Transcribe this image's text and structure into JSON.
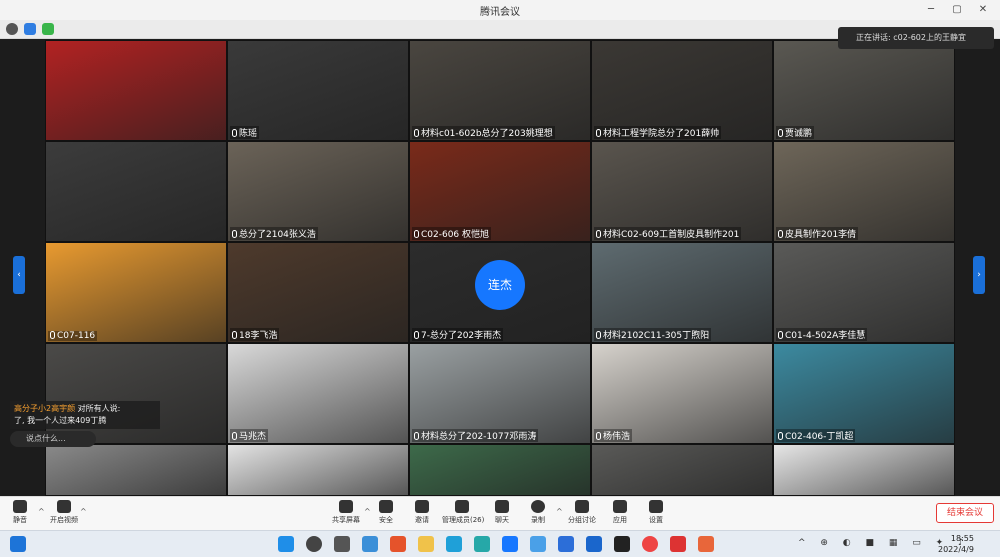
{
  "window": {
    "title": "腾讯会议"
  },
  "notification": "正在讲话: c02-602上的王静宜",
  "participants": [
    {
      "name": "",
      "color": "#b22222"
    },
    {
      "name": "陈瑶",
      "color": "#3a3a3a"
    },
    {
      "name": "材料c01-602b总分了203姚理想",
      "color": "#4a4640"
    },
    {
      "name": "材料工程学院总分了201薛帅",
      "color": "#3b3834"
    },
    {
      "name": "贾诚鹏",
      "color": "#5a5852"
    },
    {
      "name": "",
      "color": "#3c3c3c"
    },
    {
      "name": "总分了2104张义浩",
      "color": "#6b6358"
    },
    {
      "name": "C02-606 权恺旭",
      "color": "#7a2a1a"
    },
    {
      "name": "材料C02-609工首制皮具制作201",
      "color": "#5a554e"
    },
    {
      "name": "皮具制作201李倩",
      "color": "#6e6659"
    },
    {
      "name": "C07-116",
      "color": "#e89a30"
    },
    {
      "name": "18李飞浩",
      "color": "#4e3a2c"
    },
    {
      "name": "7-总分了202李雨杰",
      "color": "#2c2c2c",
      "avatar": "连杰"
    },
    {
      "name": "材料2102C11-305丁煦阳",
      "color": "#5e6b70"
    },
    {
      "name": "C01-4-502A李佳慧",
      "color": "#5a5a58"
    },
    {
      "name": "",
      "color": "#4b4a48"
    },
    {
      "name": "马兆杰",
      "color": "#d9d9d9"
    },
    {
      "name": "材料总分了202-1077邓雨涛",
      "color": "#9aa0a2"
    },
    {
      "name": "杨伟浩",
      "color": "#d6d2cc"
    },
    {
      "name": "C02-406-丁凯超",
      "color": "#3c8aa0"
    },
    {
      "name": "",
      "color": "#8a8a8a"
    },
    {
      "name": "",
      "color": "#e3e3e3"
    },
    {
      "name": "",
      "color": "#3d6a4a"
    },
    {
      "name": "",
      "color": "#5a5a58"
    },
    {
      "name": "",
      "color": "#e6e6e6"
    }
  ],
  "chat": {
    "from": "高分子小2高宇颜",
    "to": "对所有人说:",
    "text": "了, 我一个人过来409丁腾",
    "input_placeholder": "说点什么..."
  },
  "toolbar": {
    "mute": "静音",
    "video": "开启视频",
    "share": "共享屏幕",
    "security": "安全",
    "invite": "邀请",
    "manage": "管理成员(26)",
    "chat": "聊天",
    "record": "录制",
    "apps": "分组讨论",
    "apps2": "应用",
    "settings": "设置",
    "end": "结束会议"
  },
  "taskbar": {
    "time": "18:55",
    "date": "2022/4/9"
  }
}
